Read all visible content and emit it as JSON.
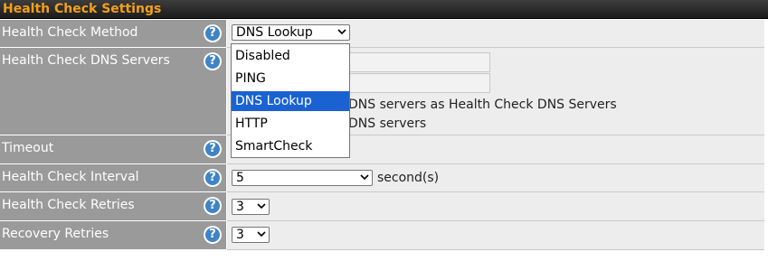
{
  "title": "Health Check Settings",
  "rows": [
    {
      "label": "Health Check Method"
    },
    {
      "label": "Health Check DNS Servers"
    },
    {
      "label": "Timeout"
    },
    {
      "label": "Health Check Interval"
    },
    {
      "label": "Health Check Retries"
    },
    {
      "label": "Recovery Retries"
    }
  ],
  "help_glyph": "?",
  "method": {
    "selected": "DNS Lookup",
    "options": [
      "Disabled",
      "PING",
      "DNS Lookup",
      "HTTP",
      "SmartCheck"
    ]
  },
  "dns": {
    "line1": "DNS servers as Health Check DNS Servers",
    "line2": "DNS servers"
  },
  "interval": {
    "value": "5",
    "unit": "second(s)"
  },
  "retries": {
    "value": "3"
  },
  "recovery_retries": {
    "value": "3"
  },
  "colors": {
    "title_text": "#f3a01a",
    "label_bg": "#9a9a9a",
    "value_bg": "#ededed",
    "help_icon": "#3f84c5",
    "selected_option": "#1a62d2"
  }
}
